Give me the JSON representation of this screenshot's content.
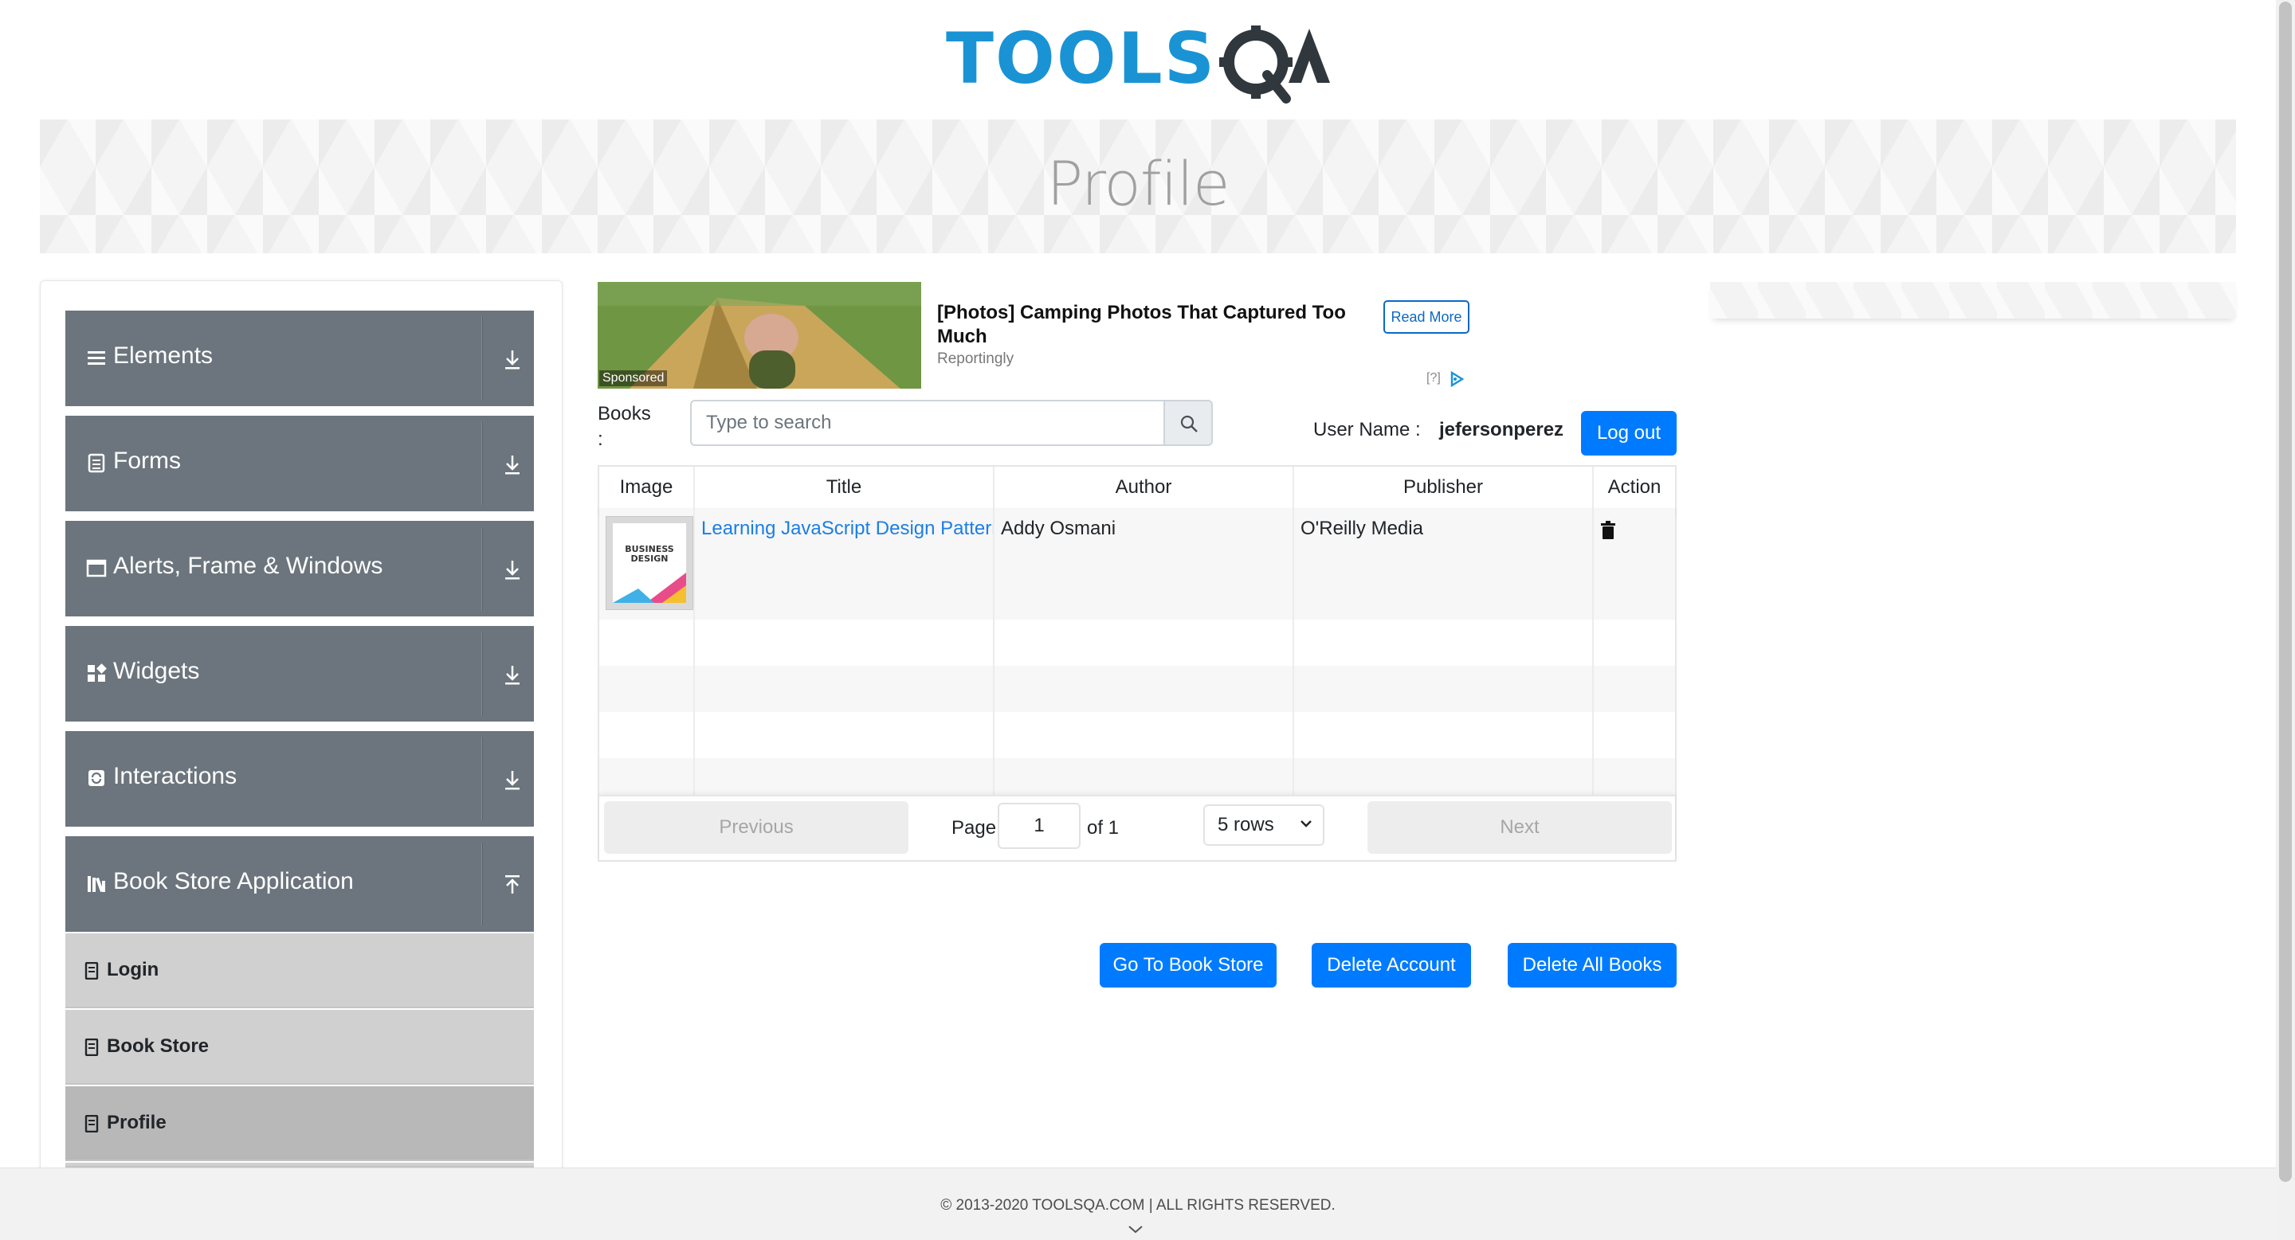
{
  "header": {
    "logo_text": "TOOLSQA",
    "page_title": "Profile"
  },
  "sidebar": {
    "groups": [
      {
        "label": "Elements",
        "icon": "list-icon",
        "expanded": false
      },
      {
        "label": "Forms",
        "icon": "form-icon",
        "expanded": false
      },
      {
        "label": "Alerts, Frame & Windows",
        "icon": "window-icon",
        "expanded": false
      },
      {
        "label": "Widgets",
        "icon": "widgets-icon",
        "expanded": false
      },
      {
        "label": "Interactions",
        "icon": "interactions-icon",
        "expanded": false
      },
      {
        "label": "Book Store Application",
        "icon": "books-icon",
        "expanded": true
      }
    ],
    "subitems": [
      {
        "label": "Login",
        "active": false
      },
      {
        "label": "Book Store",
        "active": false
      },
      {
        "label": "Profile",
        "active": true
      }
    ]
  },
  "ad": {
    "sponsored": "Sponsored",
    "title": "[Photos] Camping Photos That Captured Too Much",
    "source": "Reportingly",
    "button": "Read More",
    "choices": "[?]"
  },
  "search": {
    "books_label": "Books :",
    "placeholder": "Type to search"
  },
  "user": {
    "label": "User Name :",
    "name": "jefersonperez",
    "logout": "Log out"
  },
  "table": {
    "columns": [
      "Image",
      "Title",
      "Author",
      "Publisher",
      "Action"
    ],
    "rows": [
      {
        "title": "Learning JavaScript Design Patterns",
        "author": "Addy Osmani",
        "publisher": "O'Reilly Media"
      }
    ]
  },
  "pagination": {
    "previous": "Previous",
    "page_label": "Page",
    "page": "1",
    "of_label": "of 1",
    "rows": "5 rows",
    "next": "Next"
  },
  "actions": {
    "go_to_store": "Go To Book Store",
    "delete_account": "Delete Account",
    "delete_all_books": "Delete All Books"
  },
  "footer": {
    "copyright": "© 2013-2020 TOOLSQA.COM | ALL RIGHTS RESERVED."
  },
  "colors": {
    "primary": "#007bff",
    "menu": "#6c757d",
    "logo_blue": "#1a93d5",
    "logo_dark": "#30373d"
  }
}
